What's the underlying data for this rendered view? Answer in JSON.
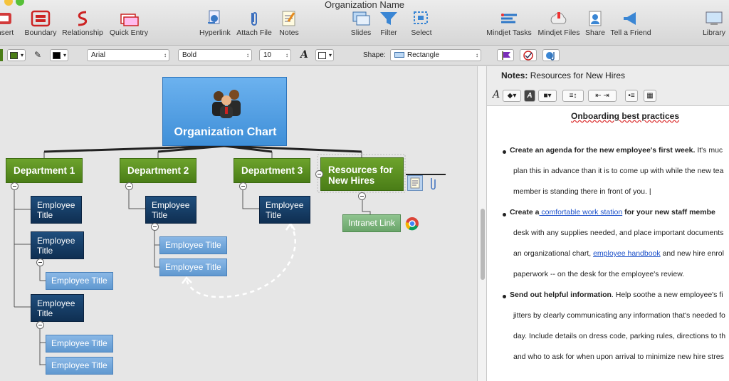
{
  "window": {
    "title": "Organization Name"
  },
  "toolbar": {
    "left": [
      "Insert",
      "Boundary",
      "Relationship",
      "Quick Entry"
    ],
    "middle": [
      "Hyperlink",
      "Attach File",
      "Notes"
    ],
    "view": [
      "Slides",
      "Filter",
      "Select"
    ],
    "right": [
      "Mindjet Tasks",
      "Mindjet Files",
      "Share",
      "Tell a Friend",
      "Library"
    ]
  },
  "format_bar": {
    "font": "Arial",
    "weight": "Bold",
    "size": "10",
    "shape_label": "Shape:",
    "shape_value": "Rectangle",
    "fill_color": "#4a7d17",
    "line_color": "#000000"
  },
  "map": {
    "central": "Organization Chart",
    "departments": [
      "Department 1",
      "Department 2",
      "Department 3"
    ],
    "resources": "Resources for New Hires",
    "intranet": "Intranet Link",
    "employee_title": "Employee Title",
    "emp_line1": "Employee",
    "emp_line2": "Title"
  },
  "notes": {
    "header_label": "Notes:",
    "header_topic": "Resources for New Hires",
    "title": "Onboarding best practices",
    "lines": [
      {
        "bold": "Create an agenda for the new employee's first week.",
        "text": " It's muc"
      },
      {
        "text": "plan this in advance than it is to come up with while the new tea"
      },
      {
        "text": "member is standing there in front of you. |"
      },
      {
        "bold": "Create a",
        "link": " comfortable work station",
        "bold2": " for your new staff membe"
      },
      {
        "text": "desk with any supplies needed, and place important documents"
      },
      {
        "text": "an organizational chart, ",
        "link": "employee handbook",
        "text2": " and new hire enrol"
      },
      {
        "text": "paperwork -- on the desk for the employee's review."
      },
      {
        "bold": "Send out helpful information",
        "text": ". Help soothe a new employee's fi"
      },
      {
        "text": "jitters by clearly communicating any information that's needed fo"
      },
      {
        "text": "day. Include details on dress code, parking rules, directions to th"
      },
      {
        "text": "and who to ask for when upon arrival to minimize new hire stres"
      }
    ]
  }
}
